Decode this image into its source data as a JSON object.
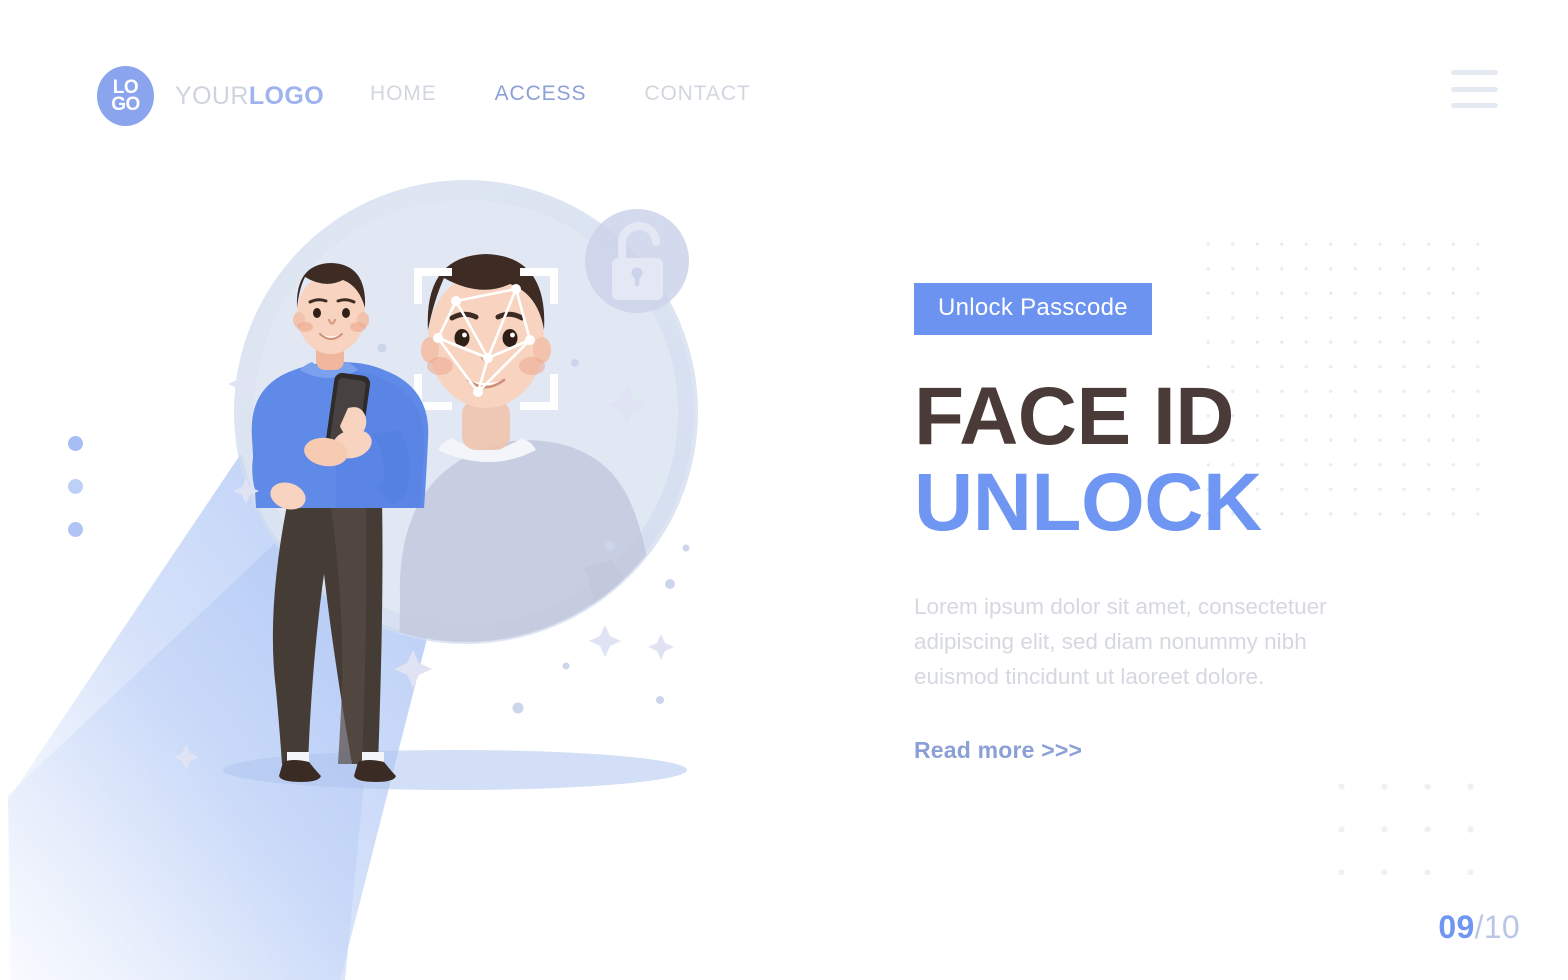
{
  "header": {
    "logo": {
      "icon": "logo-circle-icon",
      "line1": "LO",
      "line2": "GO",
      "color": "#8ba4ee"
    },
    "brand": {
      "light": "YOUR",
      "bold": "LOGO"
    },
    "nav": [
      {
        "label": "HOME",
        "active": false
      },
      {
        "label": "ACCESS",
        "active": true
      },
      {
        "label": "CONTACT",
        "active": false
      }
    ],
    "menu_icon": "hamburger-menu-icon"
  },
  "hero": {
    "badge": "Unlock Passcode",
    "headline_line1": "FACE ID",
    "headline_line2": "UNLOCK",
    "paragraph": "Lorem ipsum dolor sit amet, consectetuer adipiscing elit, sed diam nonummy nibh euismod tincidunt ut laoreet dolore.",
    "cta": "Read more >>>",
    "colors": {
      "badge_bg": "#6b93ef",
      "headline_dark": "#4a3b38",
      "headline_blue": "#6e96f2",
      "paragraph": "#d6d8e0",
      "cta": "#8ba0d6"
    }
  },
  "illustration": {
    "name": "face-id-unlock-illustration",
    "circle_color": "#dfe6f2",
    "lock_icon": "open-padlock-icon",
    "scan_frame": "face-scan-bracket-icon",
    "face_mesh": "facial-recognition-mesh-icon",
    "phone_icon": "smartphone-icon",
    "light_beam_color": "#b3c9f5",
    "shirt_color": "#5f8ae8",
    "pants_color": "#453c36"
  },
  "pager": {
    "current": "09",
    "total": "/10",
    "current_color": "#6e96f2",
    "total_color": "#b9c6e6"
  }
}
